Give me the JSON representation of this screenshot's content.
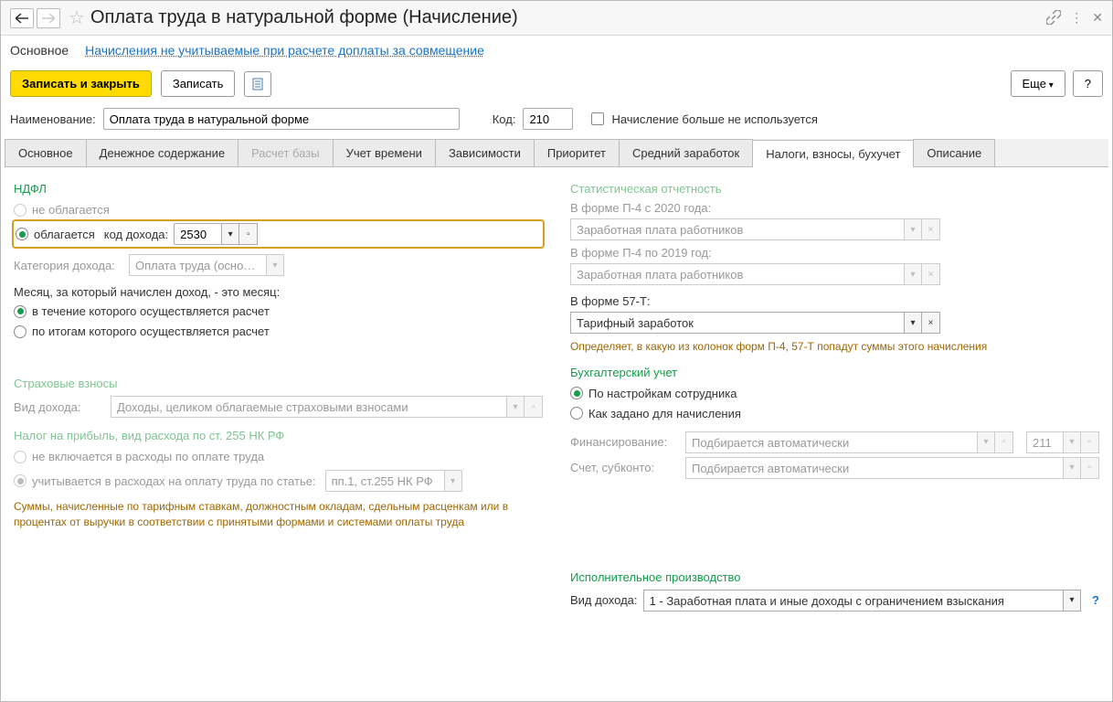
{
  "title": "Оплата труда в натуральной форме (Начисление)",
  "nav": {
    "primary": "Основное",
    "link": "Начисления не учитываемые при расчете доплаты за совмещение"
  },
  "toolbar": {
    "save_close": "Записать и закрыть",
    "save": "Записать",
    "more": "Еще",
    "help": "?"
  },
  "header": {
    "name_label": "Наименование:",
    "name_value": "Оплата труда в натуральной форме",
    "code_label": "Код:",
    "code_value": "210",
    "disabled_label": "Начисление больше не используется"
  },
  "tabs": [
    "Основное",
    "Денежное содержание",
    "Расчет базы",
    "Учет времени",
    "Зависимости",
    "Приоритет",
    "Средний заработок",
    "Налоги, взносы, бухучет",
    "Описание"
  ],
  "ndfl": {
    "title": "НДФЛ",
    "not_taxed": "не облагается",
    "taxed": "облагается",
    "code_label": "код дохода:",
    "code_value": "2530",
    "category_label": "Категория дохода:",
    "category_value": "Оплата труда (основная н",
    "month_label": "Месяц, за который начислен доход, - это месяц:",
    "month_opt1": "в течение которого осуществляется расчет",
    "month_opt2": "по итогам которого осуществляется расчет"
  },
  "insurance": {
    "title": "Страховые взносы",
    "type_label": "Вид дохода:",
    "type_value": "Доходы, целиком облагаемые страховыми взносами"
  },
  "profit_tax": {
    "title": "Налог на прибыль, вид расхода по ст. 255 НК РФ",
    "opt1": "не включается в расходы по оплате труда",
    "opt2": "учитывается в расходах на оплату труда по статье:",
    "article_value": "пп.1, ст.255 НК РФ",
    "note": "Суммы, начисленные по тарифным ставкам, должностным окладам, сдельным расценкам или в процентах от выручки в соответствии с принятыми формами и системами оплаты труда"
  },
  "stat": {
    "title": "Статистическая отчетность",
    "p4_2020_label": "В форме П-4 с 2020 года:",
    "p4_2020_value": "Заработная плата работников",
    "p4_2019_label": "В форме П-4 по 2019 год:",
    "p4_2019_value": "Заработная плата работников",
    "f57t_label": "В форме 57-Т:",
    "f57t_value": "Тарифный заработок",
    "note": "Определяет, в какую из колонок форм П-4, 57-Т попадут суммы этого начисления"
  },
  "accounting": {
    "title": "Бухгалтерский учет",
    "opt1": "По настройкам сотрудника",
    "opt2": "Как задано для начисления",
    "financing_label": "Финансирование:",
    "financing_value": "Подбирается автоматически",
    "financing_code": "211",
    "account_label": "Счет, субконто:",
    "account_value": "Подбирается автоматически"
  },
  "exec": {
    "title": "Исполнительное производство",
    "type_label": "Вид дохода:",
    "type_value": "1 - Заработная плата и иные доходы с ограничением взыскания"
  }
}
